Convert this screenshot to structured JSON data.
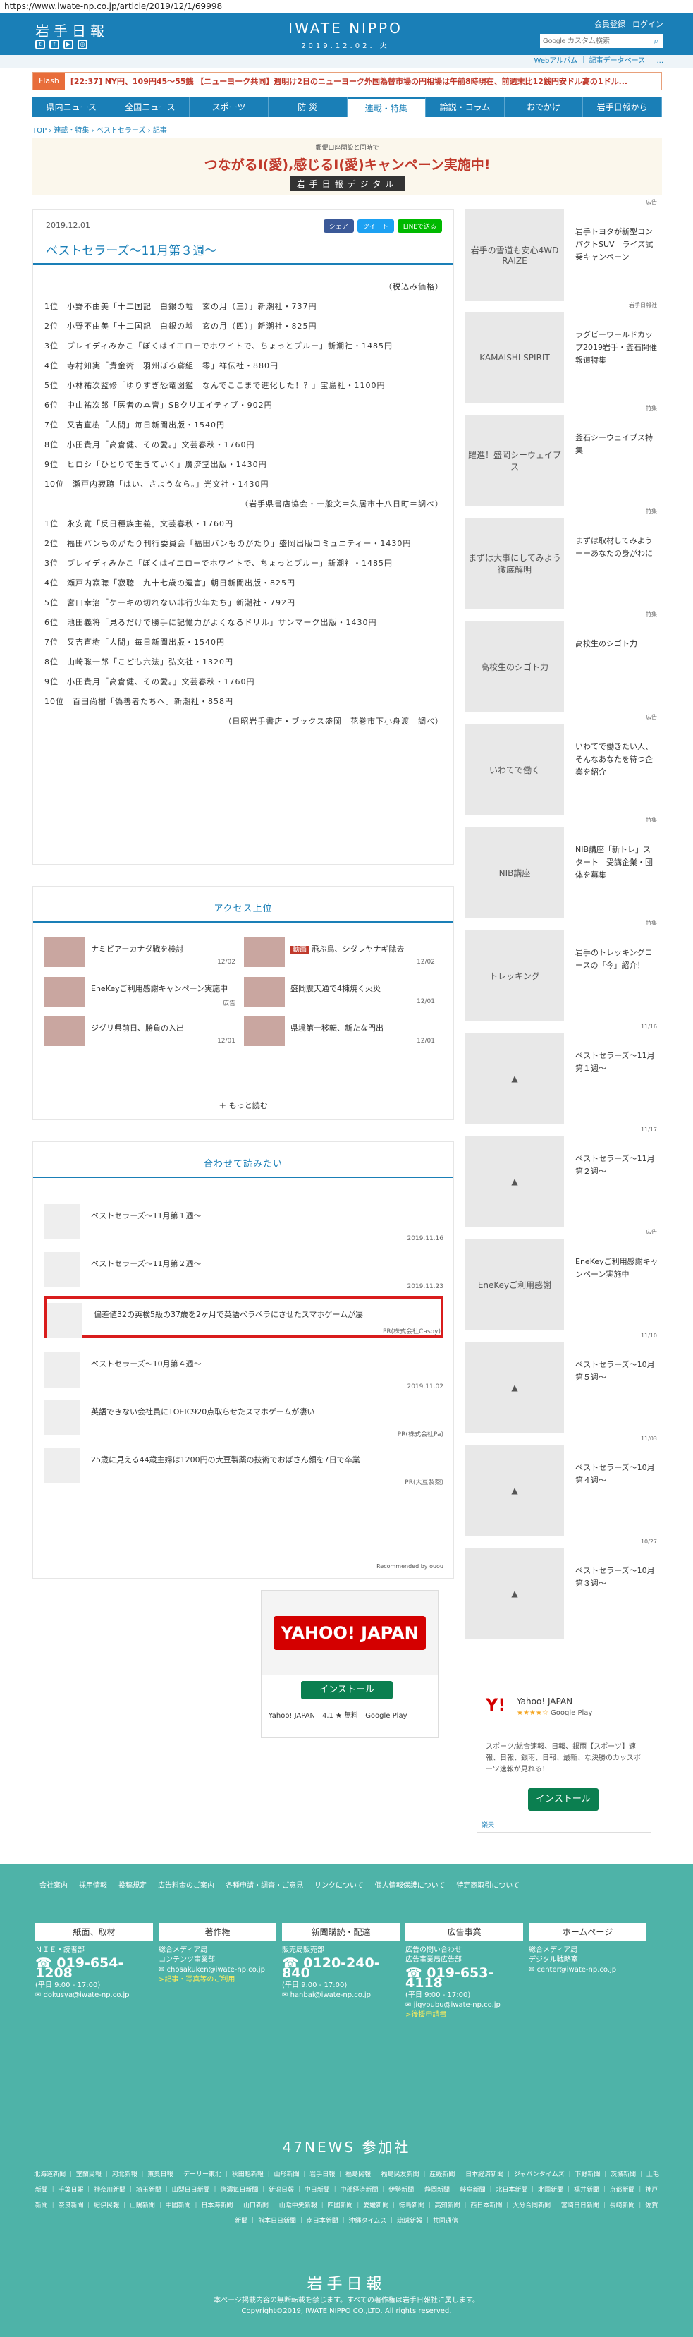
{
  "url": "https://www.iwate-np.co.jp/article/2019/12/1/69998",
  "header": {
    "logo": "岩手日報",
    "center_title": "IWATE NIPPO",
    "center_date": "2019.12.02. 火",
    "member": "会員登録",
    "login": "ログイン",
    "search_placeholder": "Google カスタム検索",
    "subbar": "Webアルバム ｜ 記事データベース ｜ ..."
  },
  "flash": {
    "label": "Flash",
    "text": "[22:37] NY円、109円45～55銭 【ニューヨーク共同】週明け2日のニューヨーク外国為替市場の円相場は午前8時現在、前週末比12銭円安ドル高の1ドル..."
  },
  "nav": [
    "県内ニュース",
    "全国ニュース",
    "スポーツ",
    "防 災",
    "連載・特集",
    "論説・コラム",
    "おでかけ",
    "岩手日報から"
  ],
  "breadcrumb": "TOP › 連載・特集 › ベストセラーズ › 記事",
  "banner": {
    "line1": "郵便口座開設と同時で",
    "line2": "つながるI(愛),感じるI(愛)キャンペーン実施中!",
    "line3": "岩手日報デジタル"
  },
  "article": {
    "date": "2019.12.01",
    "title": "ベストセラーズ〜11月第３週〜",
    "share_fb": "シェア",
    "share_tw": "ツイート",
    "share_line": "LINEで送る",
    "lines": [
      {
        "t": "（税込み価格）",
        "r": true
      },
      {
        "t": "1位　小野不由美「十二国記　白銀の墟　玄の月（三）」新潮社・737円"
      },
      {
        "t": "2位　小野不由美「十二国記　白銀の墟　玄の月（四）」新潮社・825円"
      },
      {
        "t": "3位　ブレイディみかこ「ぼくはイエローでホワイトで、ちょっとブルー」新潮社・1485円"
      },
      {
        "t": "4位　寺村知実「貴金術　羽州ぼろ鳶組　零」祥伝社・880円"
      },
      {
        "t": "5位　小林祐次監修「ゆりすぎ恐竜図鑑　なんでここまで進化した！？」宝島社・1100円"
      },
      {
        "t": "6位　中山祐次郎「医者の本音」SBクリエイティブ・902円"
      },
      {
        "t": "7位　又吉直樹「人間」毎日新聞出版・1540円"
      },
      {
        "t": "8位　小田貴月「高倉健、その愛。」文芸春秋・1760円"
      },
      {
        "t": "9位　ヒロシ「ひとりで生きていく」廣済堂出版・1430円"
      },
      {
        "t": "10位　瀬戸内寂聴「はい、さようなら。」光文社・1430円"
      },
      {
        "t": "（岩手県書店協会・一般文＝久居市十八日町＝調べ）",
        "r": true
      },
      {
        "t": "1位　永安寛「反日種族主義」文芸春秋・1760円"
      },
      {
        "t": "2位　福田バンものがたり刊行委員会「福田バンものがたり」盛岡出版コミュニティー・1430円"
      },
      {
        "t": "3位　ブレイディみかこ「ぼくはイエローでホワイトで、ちょっとブルー」新潮社・1485円"
      },
      {
        "t": "4位　瀬戸内寂聴「寂聴　九十七歳の遺言」朝日新聞出版・825円"
      },
      {
        "t": "5位　宮口幸治「ケーキの切れない非行少年たち」新潮社・792円"
      },
      {
        "t": "6位　池田義将「見るだけで勝手に記憶力がよくなるドリル」サンマーク出版・1430円"
      },
      {
        "t": "7位　又吉直樹「人間」毎日新聞出版・1540円"
      },
      {
        "t": "8位　山崎聡一郎「こども六法」弘文社・1320円"
      },
      {
        "t": "9位　小田貴月「高倉健、その愛。」文芸春秋・1760円"
      },
      {
        "t": "10位　百田尚樹「偽善者たちへ」新潮社・858円"
      },
      {
        "t": "（日昭岩手書店・ブックス盛岡＝花巻市下小舟渡＝調べ）",
        "r": true
      }
    ]
  },
  "access": {
    "title": "アクセス上位",
    "items": [
      {
        "text": "ナミビアーカナダ戦を検討",
        "date": "12/02"
      },
      {
        "tag": "動画",
        "text": "飛ぶ鳥、シダレヤナギ除去",
        "date": "12/02"
      },
      {
        "text": "EneKeyご利用感謝キャンペーン実施中",
        "date": "広告"
      },
      {
        "text": "盛岡震天通で4棟焼く火災",
        "date": "12/01"
      },
      {
        "text": "ジグリ県前日、勝負の入出",
        "date": "12/01"
      },
      {
        "text": "県境第一移転、新たな門出",
        "date": "12/01"
      }
    ],
    "more": "もっと読む"
  },
  "related": {
    "title": "合わせて読みたい",
    "items": [
      {
        "text": "ベストセラーズ〜11月第１週〜",
        "date": "2019.11.16"
      },
      {
        "text": "ベストセラーズ〜11月第２週〜",
        "date": "2019.11.23"
      },
      {
        "text": "偏差値32の英検5級の37歳を2ヶ月で英語ペラペラにさせたスマホゲームが凄",
        "date": "PR(株式会社Casoy)"
      },
      {
        "text": "ベストセラーズ〜10月第４週〜",
        "date": "2019.11.02"
      },
      {
        "text": "英語できない会社員にTOEIC920点取らせたスマホゲームが凄い",
        "date": "PR(株式会社Pa)"
      },
      {
        "text": "25歳に見える44歳主婦は1200円の大豆製薬の技術でおばさん顔を7日で卒業",
        "date": "PR(大豆製薬)"
      }
    ],
    "recommended": "Recommended by  ouou"
  },
  "ad1": {
    "logo": "YAHOO! JAPAN",
    "button": "インストール",
    "name": "Yahoo! JAPAN",
    "rating": "4.1 ★ 無料",
    "store": "Google Play"
  },
  "sidebar": [
    {
      "img": "岩手の雪道も安心4WD RAIZE",
      "text": "岩手トヨタが新型コンパクトSUV　ライズ試乗キャンペーン",
      "label": "広告"
    },
    {
      "img": "KAMAISHI SPIRIT",
      "text": "ラグビーワールドカップ2019岩手・釜石開催報道特集",
      "label": "岩手日報社"
    },
    {
      "img": "躍進！盛岡シーウェイブス",
      "text": "釜石シーウェイブス特集",
      "label": "特集"
    },
    {
      "img": "まずは大事にしてみよう 徹底解明",
      "text": "まずは取材してみようーーあなたの身がわに",
      "label": "特集"
    },
    {
      "img": "高校生のシゴト力",
      "text": "高校生のシゴト力",
      "label": "特集"
    },
    {
      "img": "いわてで働く",
      "text": "いわてで働きたい人、そんなあなたを待つ企業を紹介",
      "label": "広告"
    },
    {
      "img": "NIB講座",
      "text": "NIB講座「新トレ」スタート　受講企業・団体を募集",
      "label": "特集"
    },
    {
      "img": "トレッキング",
      "text": "岩手のトレッキングコースの「今」紹介！",
      "label": "特集"
    },
    {
      "img": "",
      "text": "ベストセラーズ〜11月第１週〜",
      "label": "11/16"
    },
    {
      "img": "",
      "text": "ベストセラーズ〜11月第２週〜",
      "label": "11/17"
    },
    {
      "img": "EneKeyご利用感謝",
      "text": "EneKeyご利用感謝キャンペーン実施中",
      "label": "広告"
    },
    {
      "img": "",
      "text": "ベストセラーズ〜10月第５週〜",
      "label": "11/10"
    },
    {
      "img": "",
      "text": "ベストセラーズ〜10月第４週〜",
      "label": "11/03"
    },
    {
      "img": "",
      "text": "ベストセラーズ〜10月第３週〜",
      "label": "10/27"
    }
  ],
  "ad2": {
    "logo": "Y!",
    "name": "Yahoo! JAPAN",
    "stars": "★★★★☆",
    "store": "Google Play",
    "desc": "スポーツ/総合速報、日報、銀雨【スポーツ】速報、日報、銀雨、日報、最新、な決勝のカッスポーツ速報が見れる！",
    "button": "インストール",
    "foot": "楽天"
  },
  "footer": {
    "links": [
      "会社案内",
      "採用情報",
      "投稿規定",
      "広告料金のご案内",
      "各種申請・調査・ご意見",
      "リンクについて",
      "個人情報保護について",
      "特定商取引について"
    ],
    "cols": [
      {
        "h": "紙面、取材",
        "l1": "ＮＩＥ・読者部",
        "tel": "019-654-1208",
        "hours": "(平日 9:00 - 17:00)",
        "mail": "dokusya@iwate-np.co.jp"
      },
      {
        "h": "著作権",
        "l1": "総合メディア局",
        "l2": "コンテンツ事業部",
        "mail": "chosakuken@iwate-np.co.jp",
        "note": ">記事・写真等のご利用"
      },
      {
        "h": "新聞購読・配達",
        "l1": "販売局販売部",
        "tel": "0120-240-840",
        "hours": "(平日 9:00 - 17:00)",
        "mail": "hanbai@iwate-np.co.jp"
      },
      {
        "h": "広告事業",
        "l1": "広告の問い合わせ",
        "l2": "広告事業局広告部",
        "tel": "019-653-4118",
        "hours": "(平日 9:00 - 17:00)",
        "mail": "jigyoubu@iwate-np.co.jp",
        "note": ">後援申請書"
      },
      {
        "h": "ホームページ",
        "l1": "総合メディア局",
        "l2": "デジタル戦略室",
        "mail": "center@iwate-np.co.jp"
      }
    ],
    "n47": "47NEWS 参加社",
    "papers": "北海道新聞 ｜ 室蘭民報 ｜ 河北新報 ｜ 東奥日報 ｜ デーリー東北 ｜ 秋田魁新報 ｜ 山形新聞 ｜ 岩手日報 ｜ 福島民報 ｜ 福島民友新聞 ｜ 産経新聞 ｜ 日本経済新聞 ｜ ジャパンタイムズ ｜ 下野新聞 ｜ 茨城新聞 ｜ 上毛新聞 ｜ 千葉日報 ｜ 神奈川新聞 ｜ 埼玉新聞 ｜ 山梨日日新聞 ｜ 信濃毎日新聞 ｜ 新潟日報 ｜ 中日新聞 ｜ 中部経済新聞 ｜ 伊勢新聞 ｜ 静岡新聞 ｜ 岐阜新聞 ｜ 北日本新聞 ｜ 北國新聞 ｜ 福井新聞 ｜ 京都新聞 ｜ 神戸新聞 ｜ 奈良新聞 ｜ 紀伊民報 ｜ 山陽新聞 ｜ 中國新聞 ｜ 日本海新聞 ｜ 山口新聞 ｜ 山陰中央新報 ｜ 四國新聞 ｜ 愛媛新聞 ｜ 徳島新聞 ｜ 高知新聞 ｜ 西日本新聞 ｜ 大分合同新聞 ｜ 宮崎日日新聞 ｜ 長崎新聞 ｜ 佐賀新聞 ｜ 熊本日日新聞 ｜ 南日本新聞 ｜ 沖縄タイムス ｜ 琉球新報 ｜ 共同通信",
    "logo": "岩手日報",
    "copy1": "本ページ掲載内容の無断転載を禁じます。すべての著作権は岩手日報社に属します。",
    "copy2": "Copyright©2019, IWATE NIPPO CO.,LTD. All rights reserved."
  }
}
